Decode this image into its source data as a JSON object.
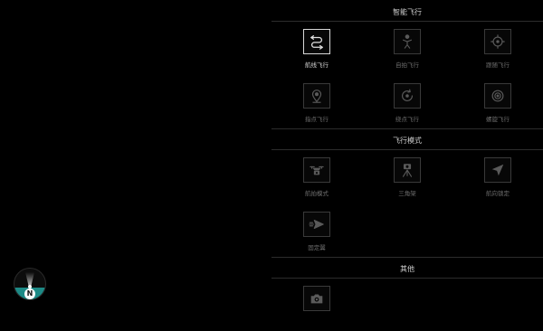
{
  "sections": {
    "smart_flight": {
      "title": "智能飞行"
    },
    "flight_mode": {
      "title": "飞行模式"
    },
    "other": {
      "title": "其他"
    }
  },
  "tiles": {
    "waypoint": {
      "label": "航线飞行",
      "icon": "route-icon",
      "selected": true
    },
    "follow": {
      "label": "自拍飞行",
      "icon": "person-icon"
    },
    "track": {
      "label": "跟随飞行",
      "icon": "crosshair-icon"
    },
    "poi": {
      "label": "指点飞行",
      "icon": "map-pin-icon"
    },
    "orbit": {
      "label": "绕点飞行",
      "icon": "orbit-icon"
    },
    "spiral": {
      "label": "螺旋飞行",
      "icon": "spiral-icon"
    },
    "aerial": {
      "label": "航拍模式",
      "icon": "drone-camera-icon"
    },
    "tripod": {
      "label": "三角架",
      "icon": "tripod-icon"
    },
    "heading_lock": {
      "label": "航向锁定",
      "icon": "navigation-arrow-icon"
    },
    "fixed_wing": {
      "label": "固定翼",
      "icon": "paper-plane-icon"
    },
    "camera": {
      "icon": "camera-icon"
    }
  },
  "compass": {
    "label": "N"
  },
  "colors": {
    "background": "#000000",
    "tile_border": "#3a3a3a",
    "selected": "#d8d8d8",
    "compass_water": "#1d8a86"
  }
}
